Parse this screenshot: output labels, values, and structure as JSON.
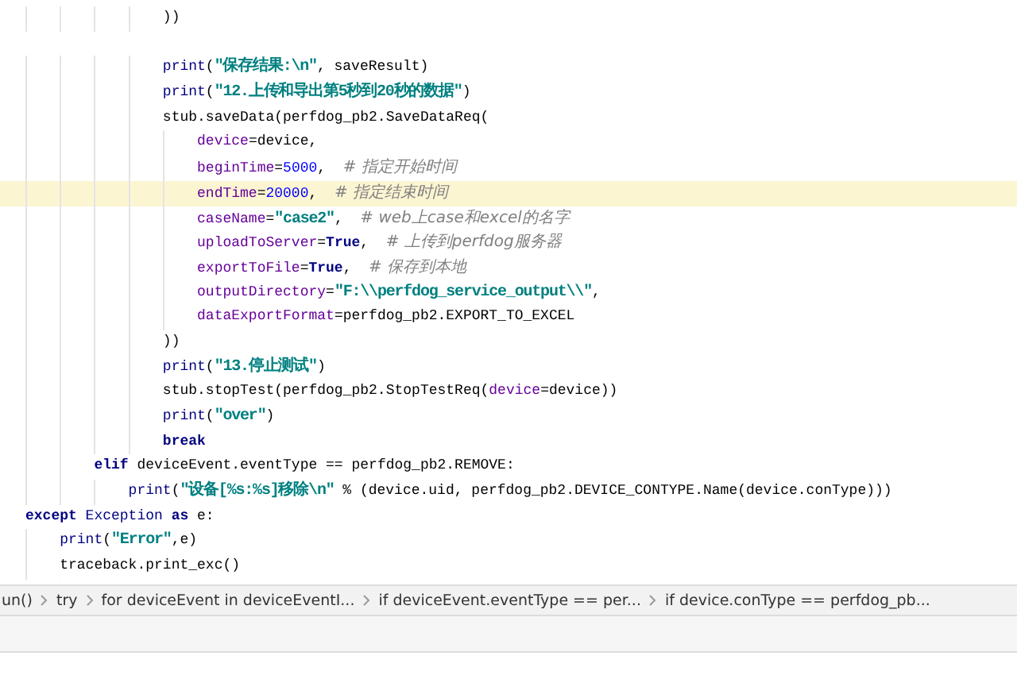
{
  "editor": {
    "lines": [
      {
        "current": false,
        "tokens": [
          {
            "kind": "plain",
            "text": "                ))"
          }
        ]
      },
      {
        "current": false
      },
      {
        "current": false,
        "tokens": [
          {
            "kind": "builtin",
            "text": "                print"
          },
          {
            "kind": "plain",
            "text": "("
          },
          {
            "kind": "string",
            "text": "\"保存结果:\\n\""
          },
          {
            "kind": "plain",
            "text": ", saveResult)"
          }
        ]
      },
      {
        "current": false,
        "tokens": [
          {
            "kind": "builtin",
            "text": "                print"
          },
          {
            "kind": "plain",
            "text": "("
          },
          {
            "kind": "string",
            "text": "\"12.上传和导出第5秒到20秒的数据\""
          },
          {
            "kind": "plain",
            "text": ")"
          }
        ]
      },
      {
        "current": false,
        "tokens": [
          {
            "kind": "plain",
            "text": "                stub.saveData(perfdog_pb2.SaveDataReq("
          }
        ]
      },
      {
        "current": false,
        "tokens": [
          {
            "kind": "kwarg",
            "text": "                    device"
          },
          {
            "kind": "plain",
            "text": "=device,"
          }
        ]
      },
      {
        "current": false,
        "tokens": [
          {
            "kind": "kwarg",
            "text": "                    beginTime"
          },
          {
            "kind": "plain",
            "text": "="
          },
          {
            "kind": "number",
            "text": "5000"
          },
          {
            "kind": "plain",
            "text": ",  "
          },
          {
            "kind": "comment",
            "text": "# 指定开始时间"
          }
        ]
      },
      {
        "current": true,
        "tokens": [
          {
            "kind": "kwarg",
            "text": "                    endTime"
          },
          {
            "kind": "plain",
            "text": "="
          },
          {
            "kind": "number",
            "text": "20000"
          },
          {
            "kind": "plain",
            "text": ",  "
          },
          {
            "kind": "comment",
            "text": "# 指定结束时间"
          }
        ]
      },
      {
        "current": false,
        "tokens": [
          {
            "kind": "kwarg",
            "text": "                    caseName"
          },
          {
            "kind": "plain",
            "text": "="
          },
          {
            "kind": "string",
            "text": "\"case2\""
          },
          {
            "kind": "plain",
            "text": ",  "
          },
          {
            "kind": "comment",
            "text": "# web上case和excel的名字"
          }
        ]
      },
      {
        "current": false,
        "tokens": [
          {
            "kind": "kwarg",
            "text": "                    uploadToServer"
          },
          {
            "kind": "plain",
            "text": "="
          },
          {
            "kind": "keyword",
            "text": "True"
          },
          {
            "kind": "plain",
            "text": ",  "
          },
          {
            "kind": "comment",
            "text": "# 上传到perfdog服务器"
          }
        ]
      },
      {
        "current": false,
        "tokens": [
          {
            "kind": "kwarg",
            "text": "                    exportToFile"
          },
          {
            "kind": "plain",
            "text": "="
          },
          {
            "kind": "keyword",
            "text": "True"
          },
          {
            "kind": "plain",
            "text": ",  "
          },
          {
            "kind": "comment",
            "text": "# 保存到本地"
          }
        ]
      },
      {
        "current": false,
        "tokens": [
          {
            "kind": "kwarg",
            "text": "                    outputDirectory"
          },
          {
            "kind": "plain",
            "text": "="
          },
          {
            "kind": "string",
            "text": "\"F:\\\\perfdog_service_output\\\\\""
          },
          {
            "kind": "plain",
            "text": ","
          }
        ]
      },
      {
        "current": false,
        "tokens": [
          {
            "kind": "kwarg",
            "text": "                    dataExportFormat"
          },
          {
            "kind": "plain",
            "text": "=perfdog_pb2.EXPORT_TO_EXCEL"
          }
        ]
      },
      {
        "current": false,
        "tokens": [
          {
            "kind": "plain",
            "text": "                ))"
          }
        ]
      },
      {
        "current": false,
        "tokens": [
          {
            "kind": "builtin",
            "text": "                print"
          },
          {
            "kind": "plain",
            "text": "("
          },
          {
            "kind": "string",
            "text": "\"13.停止测试\""
          },
          {
            "kind": "plain",
            "text": ")"
          }
        ]
      },
      {
        "current": false,
        "tokens": [
          {
            "kind": "plain",
            "text": "                stub.stopTest(perfdog_pb2.StopTestReq("
          },
          {
            "kind": "kwarg",
            "text": "device"
          },
          {
            "kind": "plain",
            "text": "=device))"
          }
        ]
      },
      {
        "current": false,
        "tokens": [
          {
            "kind": "builtin",
            "text": "                print"
          },
          {
            "kind": "plain",
            "text": "("
          },
          {
            "kind": "string",
            "text": "\"over\""
          },
          {
            "kind": "plain",
            "text": ")"
          }
        ]
      },
      {
        "current": false,
        "tokens": [
          {
            "kind": "keyword",
            "text": "                break"
          }
        ]
      },
      {
        "current": false,
        "tokens": [
          {
            "kind": "keyword",
            "text": "        elif"
          },
          {
            "kind": "plain",
            "text": " deviceEvent.eventType == perfdog_pb2.REMOVE:"
          }
        ]
      },
      {
        "current": false,
        "tokens": [
          {
            "kind": "builtin",
            "text": "            print"
          },
          {
            "kind": "plain",
            "text": "("
          },
          {
            "kind": "string",
            "text": "\"设备[%s:%s]移除\\n\""
          },
          {
            "kind": "plain",
            "text": " % (device.uid, perfdog_pb2.DEVICE_CONTYPE.Name(device.conType)))"
          }
        ]
      },
      {
        "current": false,
        "tokens": [
          {
            "kind": "keyword",
            "text": "except"
          },
          {
            "kind": "builtin",
            "text": " Exception"
          },
          {
            "kind": "keyword",
            "text": " as"
          },
          {
            "kind": "plain",
            "text": " e:"
          }
        ]
      },
      {
        "current": false,
        "tokens": [
          {
            "kind": "builtin",
            "text": "    print"
          },
          {
            "kind": "plain",
            "text": "("
          },
          {
            "kind": "string",
            "text": "\"Error\""
          },
          {
            "kind": "plain",
            "text": ",e)"
          }
        ]
      },
      {
        "current": false,
        "tokens": [
          {
            "kind": "plain",
            "text": "    traceback.print_exc()"
          }
        ]
      }
    ]
  },
  "breadcrumbs": [
    "un()",
    "try",
    "for deviceEvent in deviceEventI...",
    "if deviceEvent.eventType == per...",
    "if device.conType == perfdog_pb..."
  ]
}
